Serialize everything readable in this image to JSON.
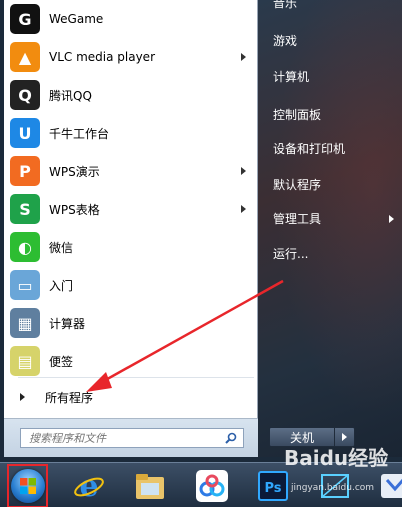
{
  "start_menu": {
    "programs": [
      {
        "label": "WeGame",
        "icon": "wegame-icon",
        "color": "#111111",
        "glyph": "G",
        "submenu": false
      },
      {
        "label": "VLC media player",
        "icon": "vlc-icon",
        "color": "#f28c0f",
        "glyph": "▲",
        "submenu": true
      },
      {
        "label": "腾讯QQ",
        "icon": "qq-penguin-icon",
        "color": "#222222",
        "glyph": "Q",
        "submenu": false
      },
      {
        "label": "千牛工作台",
        "icon": "qianniu-icon",
        "color": "#1e88e5",
        "glyph": "U",
        "submenu": false
      },
      {
        "label": "WPS演示",
        "icon": "wps-presentation-icon",
        "color": "#f26b21",
        "glyph": "P",
        "submenu": true
      },
      {
        "label": "WPS表格",
        "icon": "wps-spreadsheet-icon",
        "color": "#1fa24a",
        "glyph": "S",
        "submenu": true
      },
      {
        "label": "微信",
        "icon": "wechat-icon",
        "color": "#2dbd32",
        "glyph": "◐",
        "submenu": false
      },
      {
        "label": "入门",
        "icon": "getting-started-icon",
        "color": "#6aa6d8",
        "glyph": "▭",
        "submenu": false
      },
      {
        "label": "计算器",
        "icon": "calculator-icon",
        "color": "#5f7f9f",
        "glyph": "▦",
        "submenu": false
      },
      {
        "label": "便签",
        "icon": "sticky-notes-icon",
        "color": "#d6d36a",
        "glyph": "▤",
        "submenu": false
      }
    ],
    "all_programs_label": "所有程序",
    "search_placeholder": "搜索程序和文件"
  },
  "right_panel": {
    "items": [
      {
        "label": "音乐",
        "submenu": false
      },
      {
        "label": "游戏",
        "submenu": false
      },
      {
        "label": "计算机",
        "submenu": false
      },
      {
        "label": "控制面板",
        "submenu": false
      },
      {
        "label": "设备和打印机",
        "submenu": false
      },
      {
        "label": "默认程序",
        "submenu": false
      },
      {
        "label": "管理工具",
        "submenu": true
      },
      {
        "label": "运行...",
        "submenu": false
      }
    ],
    "shutdown_label": "关机"
  },
  "taskbar": {
    "start_button_icon": "windows-start-icon",
    "icons": [
      "internet-explorer-icon",
      "file-explorer-icon",
      "baidu-netdisk-icon",
      "photoshop-icon",
      "screenshot-tool-icon",
      "app-icon"
    ]
  },
  "watermark": {
    "text": "Baidu经验",
    "url": "jingyan.baidu.com"
  },
  "annotation": {
    "arrow_color": "#e8262b"
  }
}
